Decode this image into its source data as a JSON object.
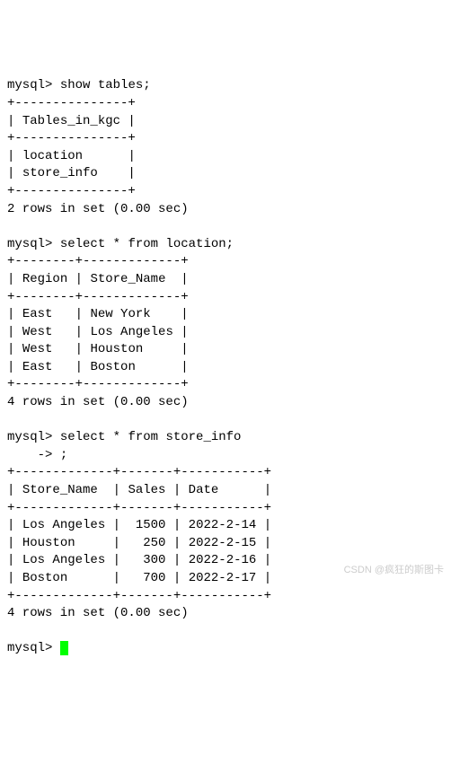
{
  "prompt": "mysql>",
  "continuation_prompt": "    ->",
  "query1": {
    "command": "show tables;",
    "header": "Tables_in_kgc",
    "rows": [
      "location",
      "store_info"
    ],
    "summary": "2 rows in set (0.00 sec)"
  },
  "query2": {
    "command": "select * from location;",
    "headers": [
      "Region",
      "Store_Name"
    ],
    "rows": [
      {
        "Region": "East",
        "Store_Name": "New York"
      },
      {
        "Region": "West",
        "Store_Name": "Los Angeles"
      },
      {
        "Region": "West",
        "Store_Name": "Houston"
      },
      {
        "Region": "East",
        "Store_Name": "Boston"
      }
    ],
    "summary": "4 rows in set (0.00 sec)"
  },
  "query3": {
    "command_line1": "select * from store_info",
    "command_line2": ";",
    "headers": [
      "Store_Name",
      "Sales",
      "Date"
    ],
    "rows": [
      {
        "Store_Name": "Los Angeles",
        "Sales": "1500",
        "Date": "2022-2-14"
      },
      {
        "Store_Name": "Houston",
        "Sales": "250",
        "Date": "2022-2-15"
      },
      {
        "Store_Name": "Los Angeles",
        "Sales": "300",
        "Date": "2022-2-16"
      },
      {
        "Store_Name": "Boston",
        "Sales": "700",
        "Date": "2022-2-17"
      }
    ],
    "summary": "4 rows in set (0.00 sec)"
  },
  "watermark": "CSDN @疯狂的斯图卡"
}
